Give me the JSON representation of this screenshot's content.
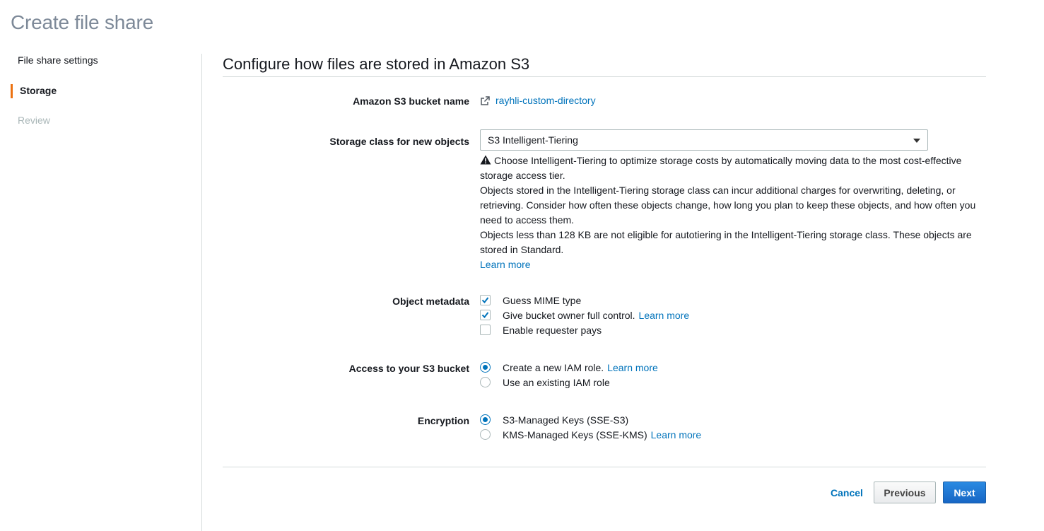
{
  "page": {
    "title": "Create file share"
  },
  "wizard": {
    "steps": [
      {
        "label": "File share settings",
        "state": "done"
      },
      {
        "label": "Storage",
        "state": "active"
      },
      {
        "label": "Review",
        "state": "pending"
      }
    ]
  },
  "section": {
    "title": "Configure how files are stored in Amazon S3"
  },
  "bucket": {
    "label": "Amazon S3 bucket name",
    "value": "rayhli-custom-directory",
    "icon": "external-link-icon"
  },
  "storage_class": {
    "label": "Storage class for new objects",
    "selected": "S3 Intelligent-Tiering",
    "warning": "Choose Intelligent-Tiering to optimize storage costs by automatically moving data to the most cost-effective storage access tier.",
    "note1": "Objects stored in the Intelligent-Tiering storage class can incur additional charges for overwriting, deleting, or retrieving. Consider how often these objects change, how long you plan to keep these objects, and how often you need to access them.",
    "note2": "Objects less than 128 KB are not eligible for autotiering in the Intelligent-Tiering storage class. These objects are stored in Standard.",
    "learn_more": "Learn more"
  },
  "metadata": {
    "label": "Object metadata",
    "options": [
      {
        "label": "Guess MIME type",
        "checked": true
      },
      {
        "label": "Give bucket owner full control.",
        "checked": true,
        "link": "Learn more"
      },
      {
        "label": "Enable requester pays",
        "checked": false
      }
    ]
  },
  "access": {
    "label": "Access to your S3 bucket",
    "options": [
      {
        "label": "Create a new IAM role.",
        "selected": true,
        "link": "Learn more"
      },
      {
        "label": "Use an existing IAM role",
        "selected": false
      }
    ]
  },
  "encryption": {
    "label": "Encryption",
    "options": [
      {
        "label": "S3-Managed Keys (SSE-S3)",
        "selected": true
      },
      {
        "label": "KMS-Managed Keys (SSE-KMS)",
        "selected": false,
        "link": "Learn more"
      }
    ]
  },
  "footer": {
    "cancel": "Cancel",
    "previous": "Previous",
    "next": "Next"
  },
  "colors": {
    "accent": "#0073bb",
    "active_step": "#ec7211",
    "primary_button": "#1766c5"
  }
}
